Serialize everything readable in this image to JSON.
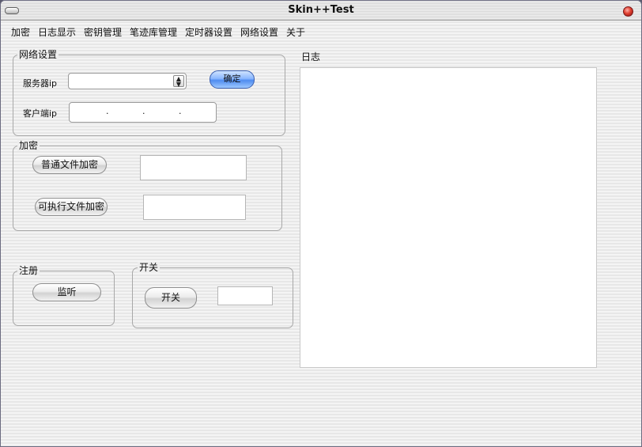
{
  "window": {
    "title": "Skin++Test"
  },
  "menu": [
    "加密",
    "日志显示",
    "密钥管理",
    "笔迹库管理",
    "定时器设置",
    "网络设置",
    "关于"
  ],
  "network": {
    "group_label": "网络设置",
    "server_ip_label": "服务器ip",
    "server_ip_value": "",
    "client_ip_label": "客户端ip",
    "client_ip_dots": [
      ".",
      ".",
      "."
    ],
    "confirm_label": "确定"
  },
  "encrypt": {
    "group_label": "加密",
    "normal_button": "普通文件加密",
    "exec_button": "可执行文件加密"
  },
  "register": {
    "group_label": "注册",
    "listen_button": "监听"
  },
  "switch": {
    "group_label": "开关",
    "switch_button": "开关"
  },
  "log": {
    "label": "日志"
  }
}
